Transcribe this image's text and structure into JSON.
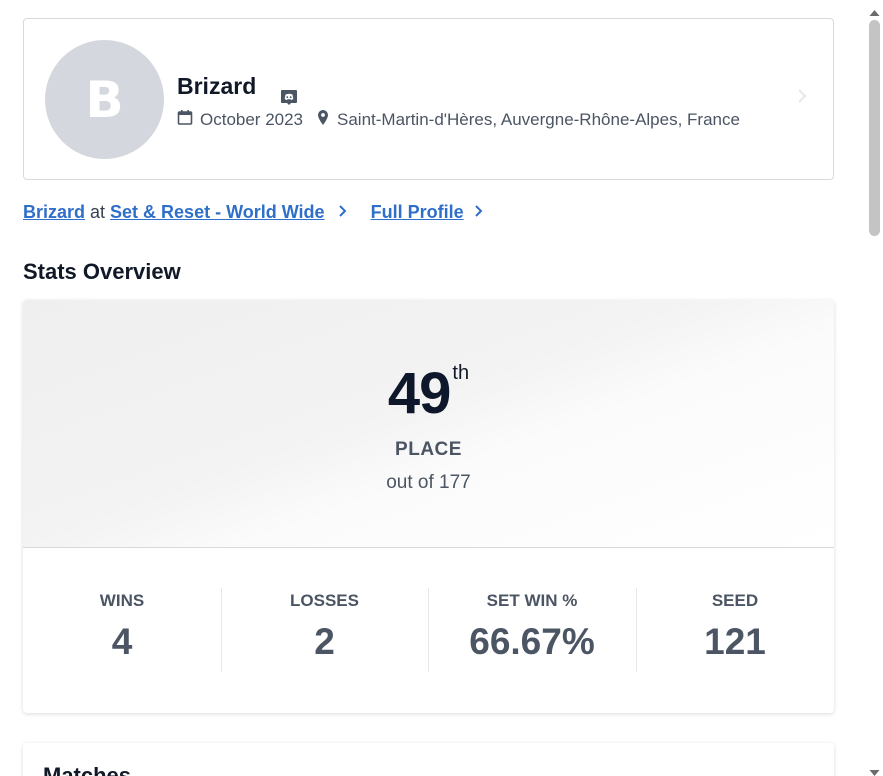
{
  "profile": {
    "avatar_initial": "B",
    "name": "Brizard",
    "join_date": "October 2023",
    "location": "Saint-Martin-d'Hères, Auvergne-Rhône-Alpes, France"
  },
  "links": {
    "player_link": "Brizard",
    "at_text": "at",
    "event_link": "Set & Reset - World Wide",
    "full_profile": "Full Profile"
  },
  "stats_overview": {
    "title": "Stats Overview",
    "placement": "49",
    "placement_suffix": "th",
    "placement_label": "PLACE",
    "out_of": "out of 177",
    "stats": [
      {
        "label": "WINS",
        "value": "4"
      },
      {
        "label": "LOSSES",
        "value": "2"
      },
      {
        "label": "SET WIN %",
        "value": "66.67%"
      },
      {
        "label": "SEED",
        "value": "121"
      }
    ]
  },
  "matches": {
    "title": "Matches"
  },
  "colors": {
    "link": "#2f6fc9",
    "avatar_bg": "#d4d8de",
    "stat_text": "#4b5563"
  },
  "icons": [
    "discord-icon",
    "calendar-icon",
    "location-pin-icon",
    "chevron-right-icon"
  ]
}
